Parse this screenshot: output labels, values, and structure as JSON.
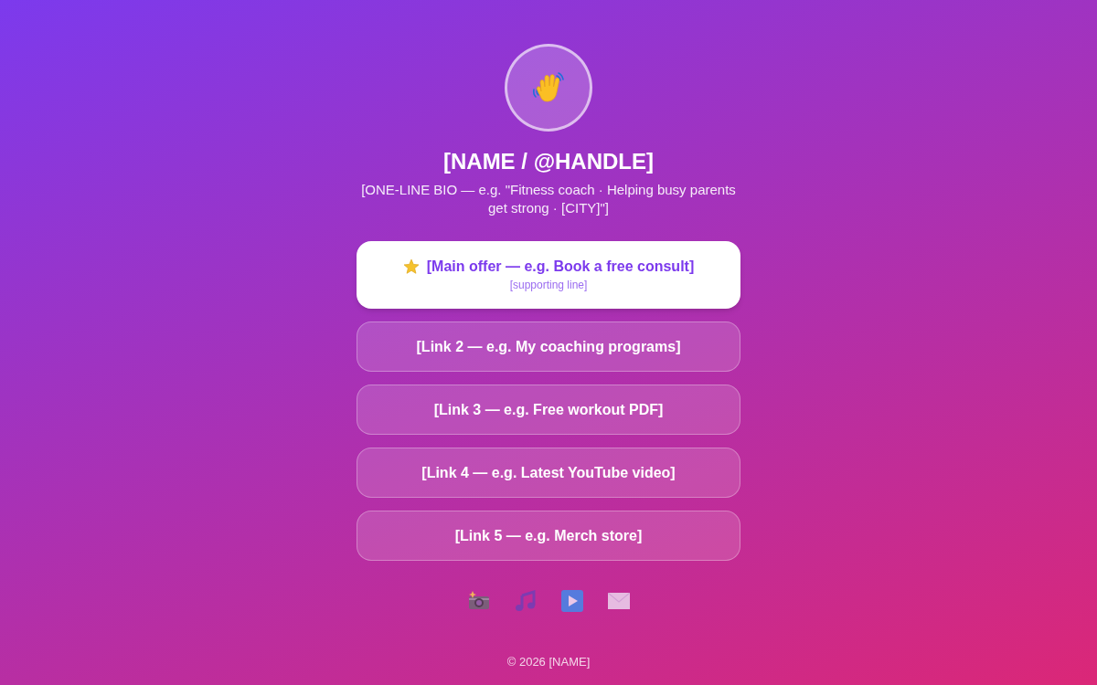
{
  "profile": {
    "name": "[NAME / @HANDLE]",
    "bio": "[ONE-LINE BIO — e.g. \"Fitness coach · Helping busy parents get strong · [CITY]\"]"
  },
  "links": [
    {
      "kind": "featured",
      "title": "[Main offer — e.g. Book a free consult]",
      "subtitle": "[supporting line]"
    },
    {
      "kind": "standard",
      "title": "[Link 2 — e.g. My coaching programs]"
    },
    {
      "kind": "standard",
      "title": "[Link 3 — e.g. Free workout PDF]"
    },
    {
      "kind": "standard",
      "title": "[Link 4 — e.g. Latest YouTube video]"
    },
    {
      "kind": "standard",
      "title": "[Link 5 — e.g. Merch store]"
    }
  ],
  "footer": "© 2026 [NAME]"
}
